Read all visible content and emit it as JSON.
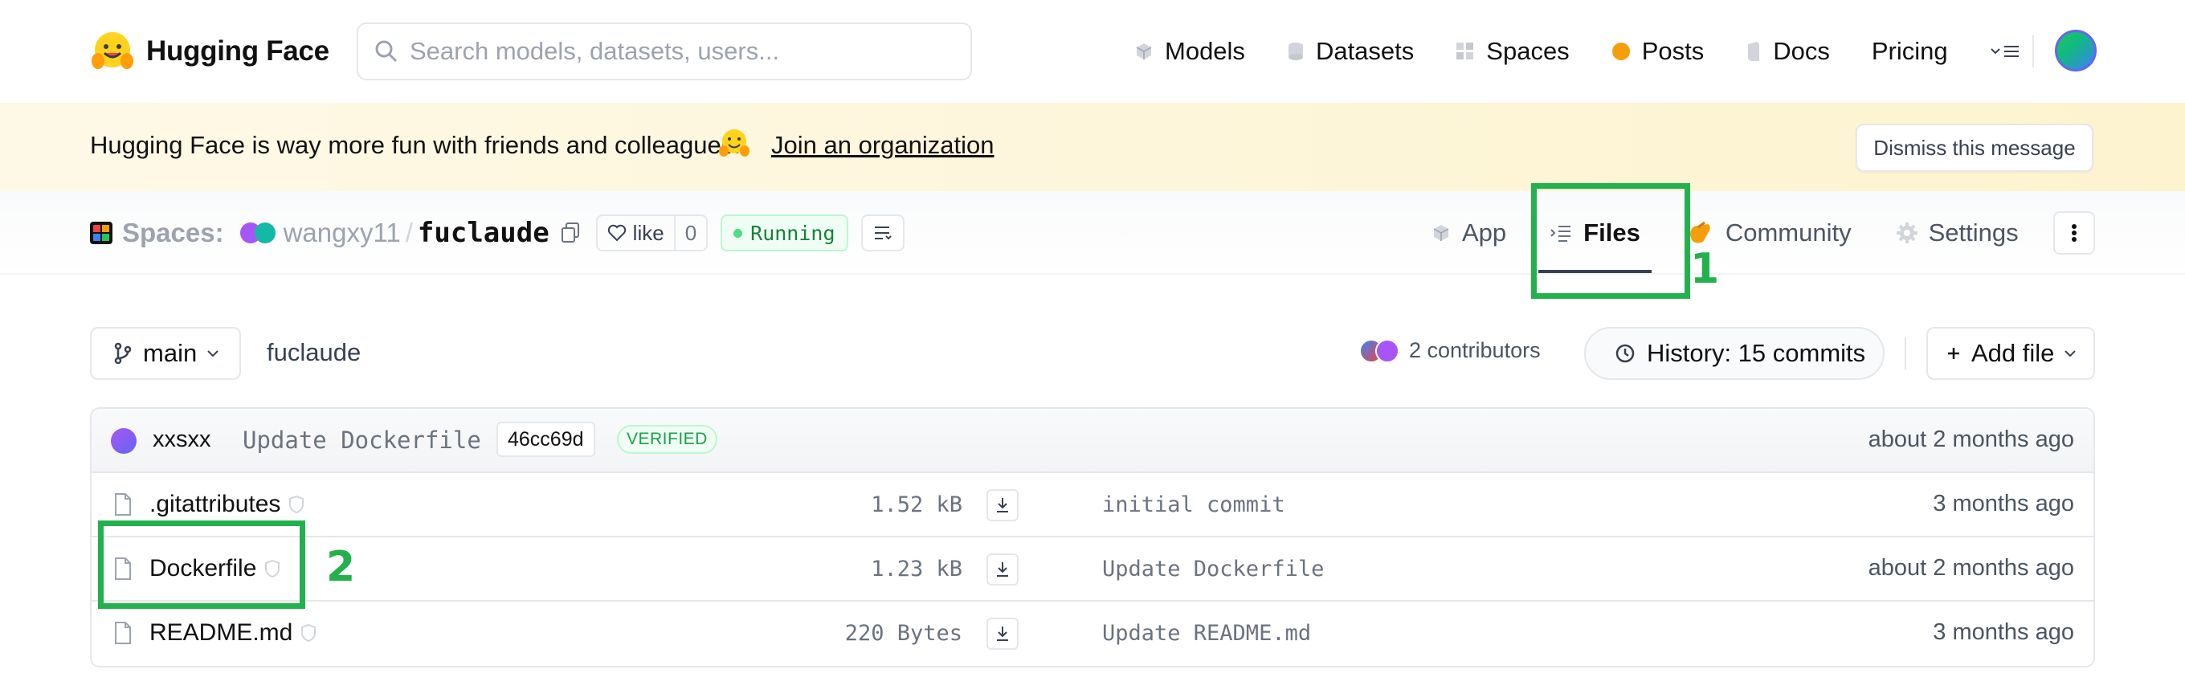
{
  "nav": {
    "brand": "Hugging Face",
    "search_placeholder": "Search models, datasets, users...",
    "links": [
      {
        "label": "Models",
        "icon": "cube-icon"
      },
      {
        "label": "Datasets",
        "icon": "database-icon"
      },
      {
        "label": "Spaces",
        "icon": "spaces-grid-icon"
      },
      {
        "label": "Posts",
        "icon": "speech-bubble-icon"
      },
      {
        "label": "Docs",
        "icon": "book-icon"
      },
      {
        "label": "Pricing",
        "icon": ""
      }
    ]
  },
  "banner": {
    "text": "Hugging Face is way more fun with friends and colleagues!",
    "link": "Join an organization",
    "dismiss": "Dismiss this message"
  },
  "repo": {
    "section_label": "Spaces:",
    "owner": "wangxy11",
    "separator": "/",
    "name": "fuclaude",
    "like_label": "like",
    "like_count": "0",
    "status": "Running",
    "tabs": [
      {
        "label": "App",
        "icon": "cube-icon"
      },
      {
        "label": "Files",
        "icon": "files-icon",
        "active": true
      },
      {
        "label": "Community",
        "icon": "community-icon"
      },
      {
        "label": "Settings",
        "icon": "gear-icon"
      }
    ]
  },
  "toolbar": {
    "branch": "main",
    "path": "fuclaude",
    "contributors": "2 contributors",
    "history": "History: 15 commits",
    "add_file": "Add file"
  },
  "last_commit": {
    "author": "xxsxx",
    "message": "Update Dockerfile",
    "sha": "46cc69d",
    "verified": "VERIFIED",
    "time": "about 2 months ago"
  },
  "files": [
    {
      "name": ".gitattributes",
      "size": "1.52 kB",
      "commit": "initial commit",
      "time": "3 months ago"
    },
    {
      "name": "Dockerfile",
      "size": "1.23 kB",
      "commit": "Update Dockerfile",
      "time": "about 2 months ago"
    },
    {
      "name": "README.md",
      "size": "220 Bytes",
      "commit": "Update README.md",
      "time": "3 months ago"
    }
  ],
  "annotations": {
    "one": "1",
    "two": "2"
  },
  "colors": {
    "annotation": "#22b14c",
    "running": "#15803d",
    "verified": "#16a34a"
  }
}
